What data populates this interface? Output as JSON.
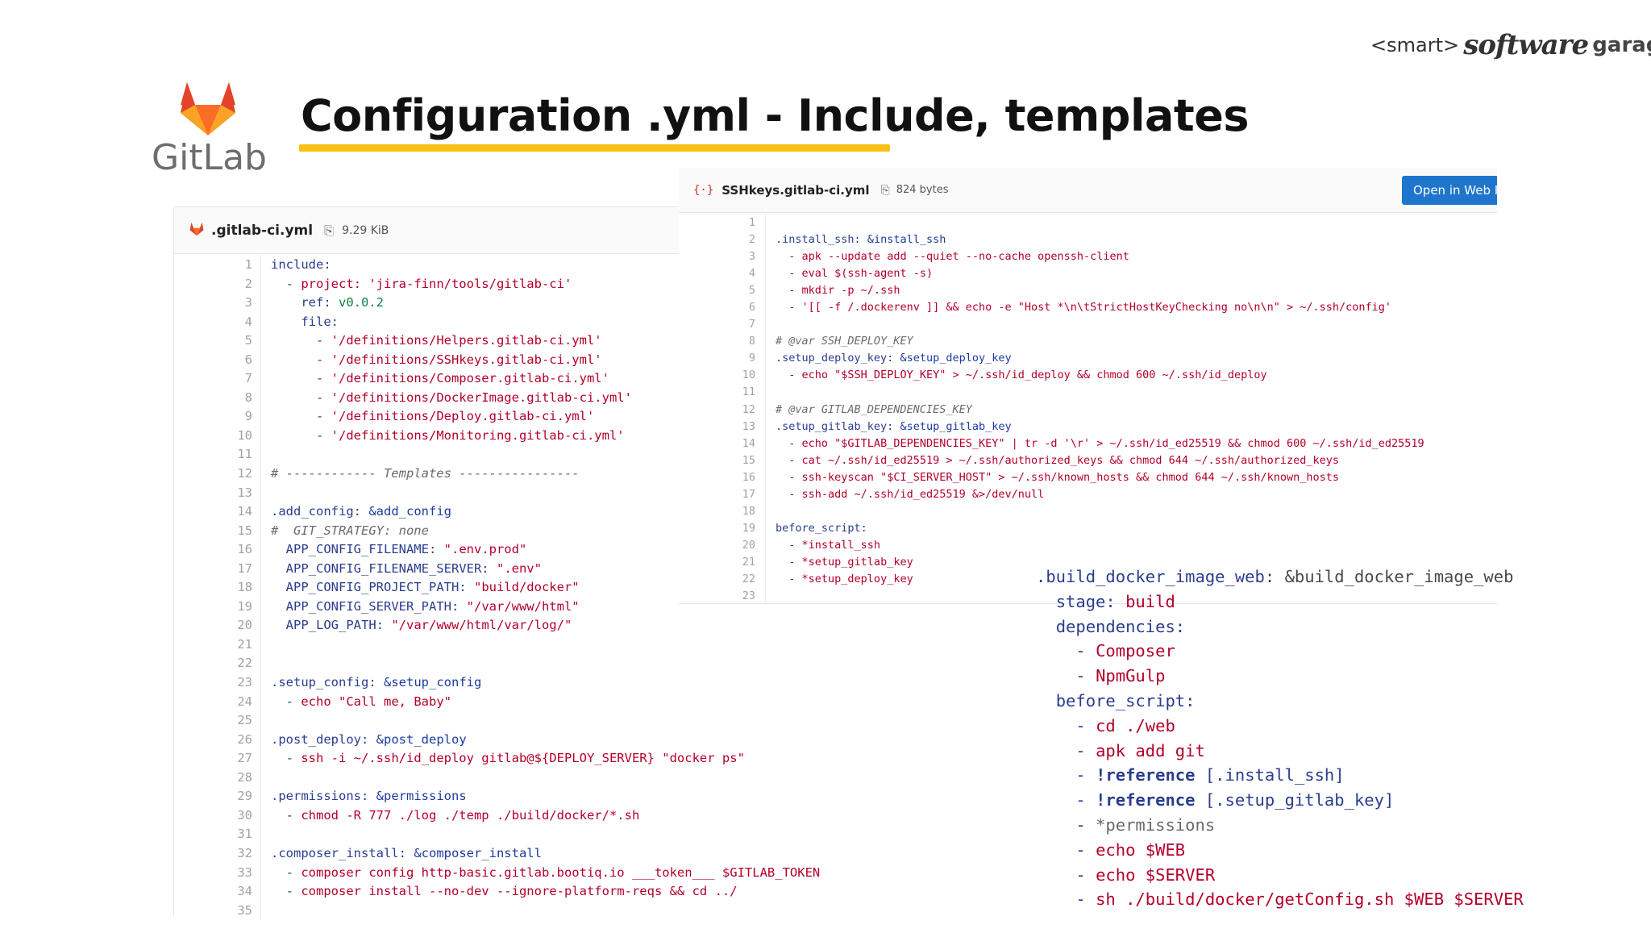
{
  "brand": {
    "prefix": "<smart>",
    "script": "software",
    "suffix": "garage"
  },
  "logo": {
    "wordmark": "GitLab"
  },
  "slide": {
    "title": "Configuration .yml  - Include, templates"
  },
  "left_file": {
    "name": ".gitlab-ci.yml",
    "size": "9.29 KiB",
    "lines": [
      "include:",
      "  - project: 'jira-finn/tools/gitlab-ci'",
      "    ref: v0.0.2",
      "    file:",
      "      - '/definitions/Helpers.gitlab-ci.yml'",
      "      - '/definitions/SSHkeys.gitlab-ci.yml'",
      "      - '/definitions/Composer.gitlab-ci.yml'",
      "      - '/definitions/DockerImage.gitlab-ci.yml'",
      "      - '/definitions/Deploy.gitlab-ci.yml'",
      "      - '/definitions/Monitoring.gitlab-ci.yml'",
      "",
      "# ------------ Templates ----------------",
      "",
      ".add_config: &add_config",
      "#  GIT_STRATEGY: none",
      "  APP_CONFIG_FILENAME: \".env.prod\"",
      "  APP_CONFIG_FILENAME_SERVER: \".env\"",
      "  APP_CONFIG_PROJECT_PATH: \"build/docker\"",
      "  APP_CONFIG_SERVER_PATH: \"/var/www/html\"",
      "  APP_LOG_PATH: \"/var/www/html/var/log/\"",
      "",
      "",
      ".setup_config: &setup_config",
      "  - echo \"Call me, Baby\"",
      "",
      ".post_deploy: &post_deploy",
      "  - ssh -i ~/.ssh/id_deploy gitlab@${DEPLOY_SERVER} \"docker ps\"",
      "",
      ".permissions: &permissions",
      "  - chmod -R 777 ./log ./temp ./build/docker/*.sh",
      "",
      ".composer_install: &composer_install",
      "  - composer config http-basic.gitlab.bootiq.io ___token___ $GITLAB_TOKEN",
      "  - composer install --no-dev --ignore-platform-reqs && cd ../",
      ""
    ]
  },
  "right_file": {
    "name": "SSHkeys.gitlab-ci.yml",
    "size": "824 bytes",
    "open_button": "Open in Web I",
    "lines": [
      "",
      ".install_ssh: &install_ssh",
      "  - apk --update add --quiet --no-cache openssh-client",
      "  - eval $(ssh-agent -s)",
      "  - mkdir -p ~/.ssh",
      "  - '[[ -f /.dockerenv ]] && echo -e \"Host *\\n\\tStrictHostKeyChecking no\\n\\n\" > ~/.ssh/config'",
      "",
      "# @var SSH_DEPLOY_KEY",
      ".setup_deploy_key: &setup_deploy_key",
      "  - echo \"$SSH_DEPLOY_KEY\" > ~/.ssh/id_deploy && chmod 600 ~/.ssh/id_deploy",
      "",
      "# @var GITLAB_DEPENDENCIES_KEY",
      ".setup_gitlab_key: &setup_gitlab_key",
      "  - echo \"$GITLAB_DEPENDENCIES_KEY\" | tr -d '\\r' > ~/.ssh/id_ed25519 && chmod 600 ~/.ssh/id_ed25519",
      "  - cat ~/.ssh/id_ed25519 > ~/.ssh/authorized_keys && chmod 644 ~/.ssh/authorized_keys",
      "  - ssh-keyscan \"$CI_SERVER_HOST\" > ~/.ssh/known_hosts && chmod 644 ~/.ssh/known_hosts",
      "  - ssh-add ~/.ssh/id_ed25519 &>/dev/null",
      "",
      "before_script:",
      "  - *install_ssh",
      "  - *setup_gitlab_key",
      "  - *setup_deploy_key",
      ""
    ]
  },
  "snippet": {
    "lines": [
      ".build_docker_image_web: &build_docker_image_web",
      "  stage: build",
      "  dependencies:",
      "    - Composer",
      "    - NpmGulp",
      "  before_script:",
      "    - cd ./web",
      "    - apk add git",
      "    - !reference [.install_ssh]",
      "    - !reference [.setup_gitlab_key]",
      "    - *permissions",
      "    - echo $WEB",
      "    - echo $SERVER",
      "    - sh ./build/docker/getConfig.sh $WEB $SERVER"
    ]
  }
}
